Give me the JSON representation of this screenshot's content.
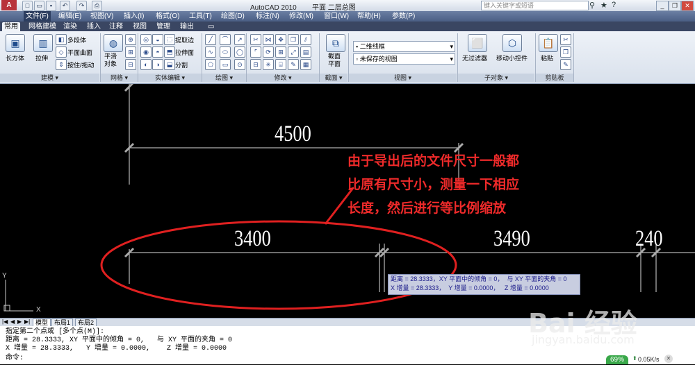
{
  "app": {
    "title": "AutoCAD 2010",
    "document_title": "平面  二层总图",
    "search_placeholder": "键入关键字或短语"
  },
  "menus": [
    "文件(F)",
    "编辑(E)",
    "视图(V)",
    "插入(I)",
    "格式(O)",
    "工具(T)",
    "绘图(D)",
    "标注(N)",
    "修改(M)",
    "窗口(W)",
    "帮助(H)",
    "参数(P)"
  ],
  "ribbon_tabs": [
    "常用",
    "网格建模",
    "渲染",
    "插入",
    "注释",
    "视图",
    "管理",
    "输出"
  ],
  "ribbon": {
    "modeling": {
      "box": "长方体",
      "extrude": "拉伸",
      "polysolid": "多段体",
      "planar_surface": "平面曲面",
      "presspull": "按住/拖动",
      "panel_title": "建模"
    },
    "mesh": {
      "smooth_object": "平滑\n对象",
      "panel_title": "网格"
    },
    "solid_editing": {
      "extract_edges": "提取边",
      "extrude_faces": "拉伸面",
      "separate": "分割",
      "panel_title": "实体编辑"
    },
    "draw": {
      "panel_title": "绘图"
    },
    "modify": {
      "panel_title": "修改"
    },
    "section": {
      "section_plane": "截面\n平面",
      "panel_title": "截面"
    },
    "view": {
      "visual_style": "二维线框",
      "named_view": "未保存的视图",
      "panel_title": "视图"
    },
    "subobject": {
      "no_filter": "无过滤器",
      "move_gizmo": "移动小控件",
      "panel_title": "子对象"
    },
    "clipboard": {
      "paste": "粘贴",
      "panel_title": "剪贴板"
    }
  },
  "drawing": {
    "dimensions": [
      "4500",
      "3400",
      "3490",
      "240"
    ],
    "annotation_lines": [
      "由于导出后的文件尺寸一般都",
      "比原有尺寸小，测量一下相应",
      "长度，然后进行等比例缩放"
    ],
    "tooltip_lines": [
      "距离 = 28.3333，XY 平面中的倾角 = 0，  与 XY 平面的夹角 = 0",
      "X 增量 = 28.3333，  Y 增量 = 0.0000，   Z 增量 = 0.0000"
    ],
    "ucs_y": "Y",
    "ucs_x": "X"
  },
  "layout_tabs": [
    "模型",
    "布局1",
    "布局2"
  ],
  "command": {
    "lines": [
      "指定第二个点或 [多个点(M)]:",
      "距离 = 28.3333, XY 平面中的倾角 = 0,   与 XY 平面的夹角 = 0",
      "X 增量 = 28.3333,   Y 增量 = 0.0000,    Z 增量 = 0.0000"
    ],
    "prompt": "命令:"
  },
  "status": {
    "percent": "69%",
    "speed": "0.05K/s"
  },
  "watermark": {
    "brand": "Bai 经验",
    "url": "jingyan.baidu.com"
  }
}
